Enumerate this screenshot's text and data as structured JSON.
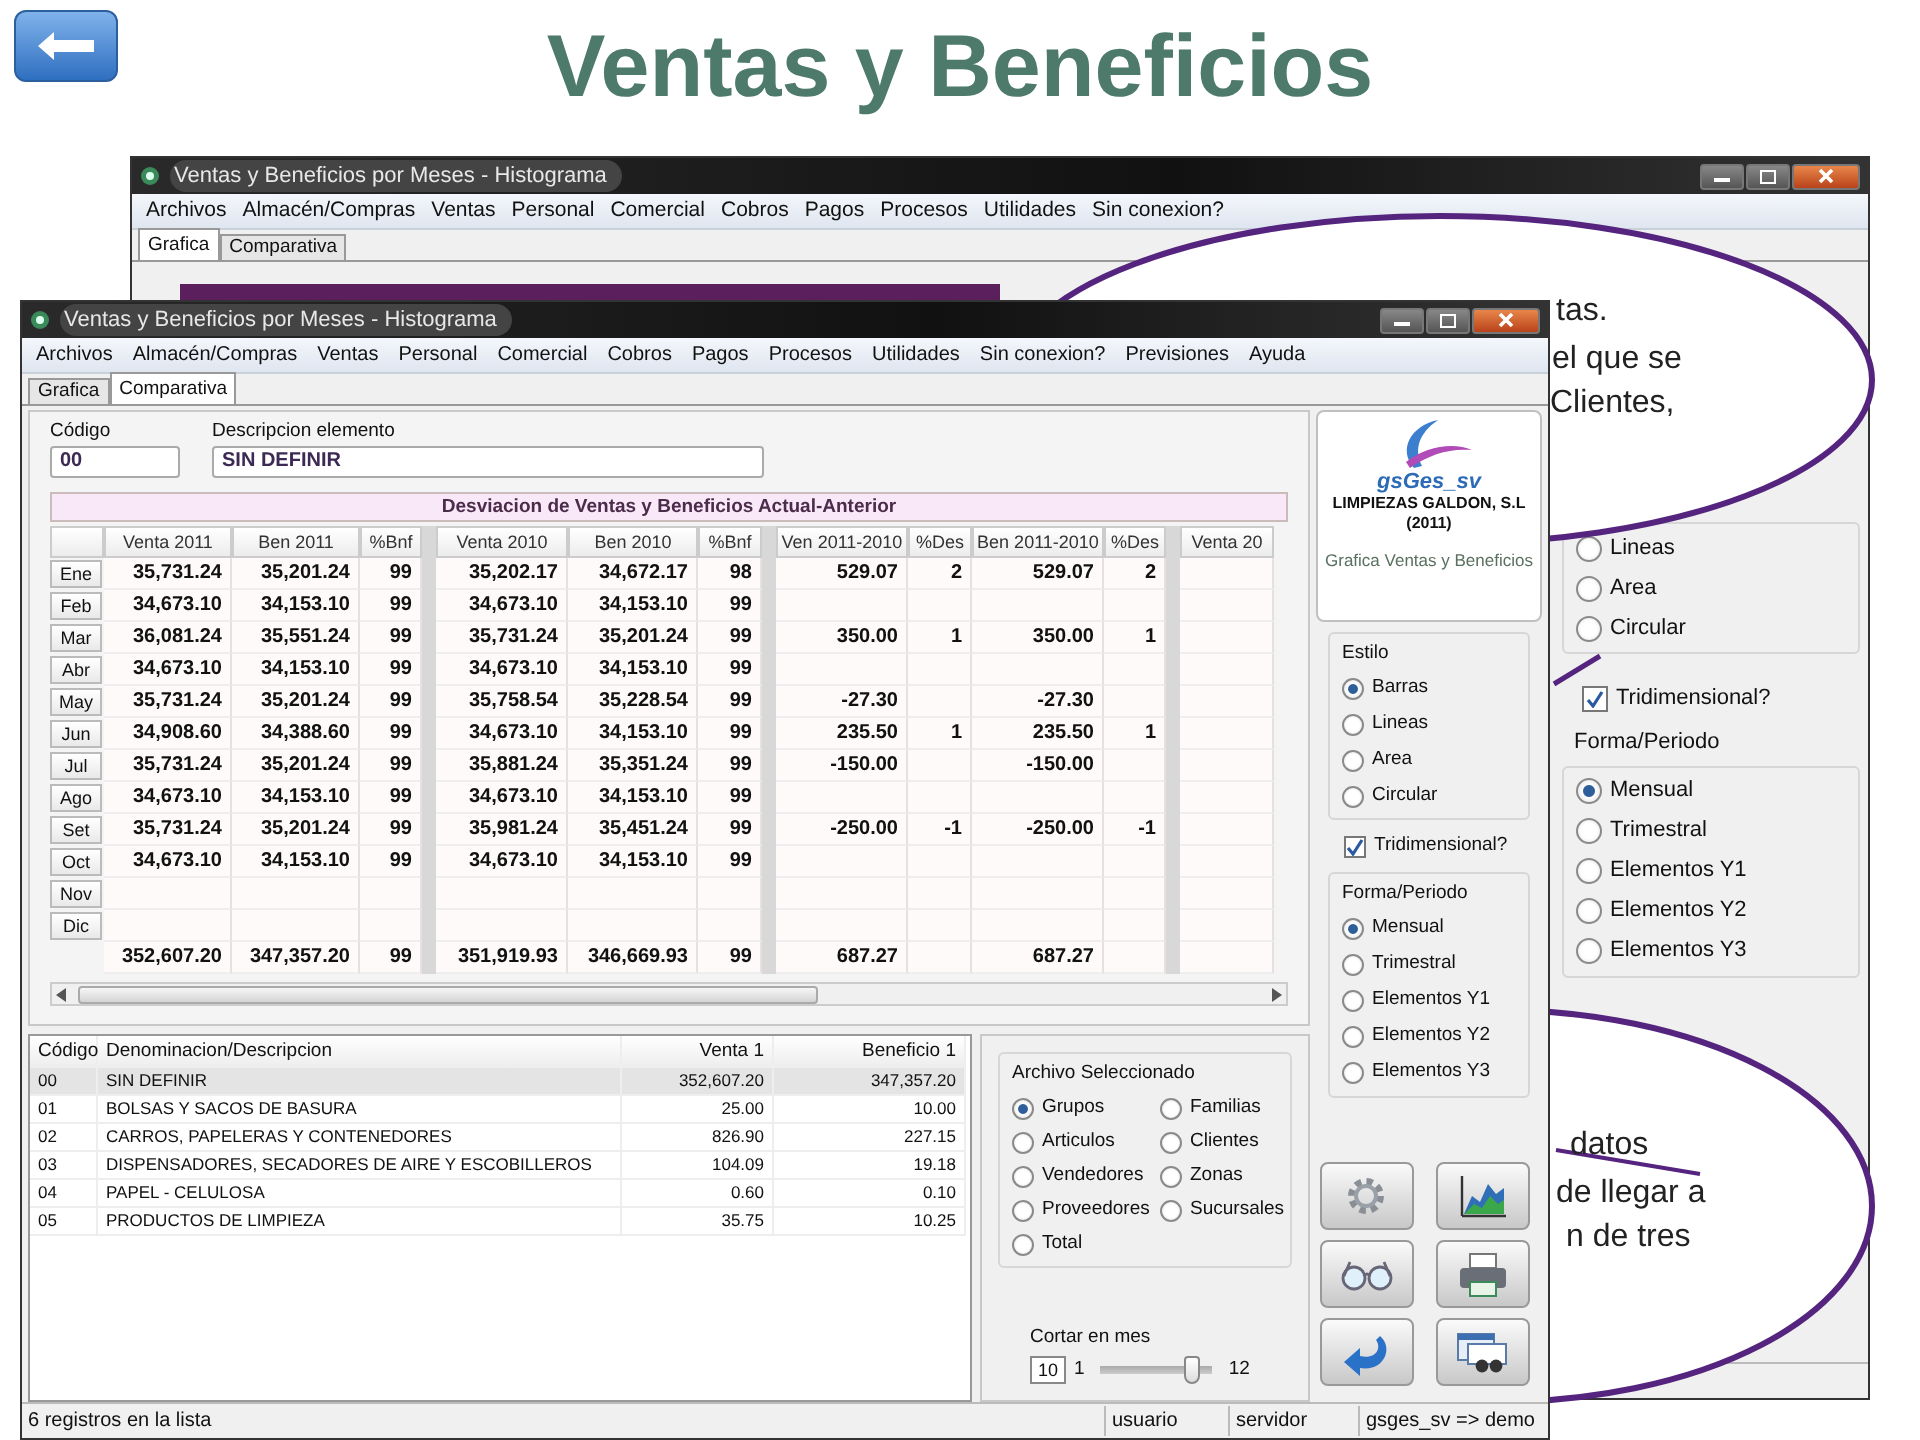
{
  "slide": {
    "title": "Ventas y Beneficios"
  },
  "background_window": {
    "title": "Ventas y Beneficios por Meses - Histograma",
    "menu": [
      "Archivos",
      "Almacén/Compras",
      "Ventas",
      "Personal",
      "Comercial",
      "Cobros",
      "Pagos",
      "Procesos",
      "Utilidades",
      "Sin conexion?"
    ],
    "tabs": [
      {
        "label": "Grafica",
        "selected": true
      },
      {
        "label": "Comparativa",
        "selected": false
      }
    ],
    "style_options": [
      {
        "label": "Lineas",
        "selected": false
      },
      {
        "label": "Area",
        "selected": false
      },
      {
        "label": "Circular",
        "selected": false
      }
    ],
    "tridimensional": {
      "label": "Tridimensional?",
      "checked": true
    },
    "period_group": {
      "title": "Forma/Periodo",
      "options": [
        {
          "label": "Mensual",
          "selected": true
        },
        {
          "label": "Trimestral",
          "selected": false
        },
        {
          "label": "Elementos Y1",
          "selected": false
        },
        {
          "label": "Elementos Y2",
          "selected": false
        },
        {
          "label": "Elementos Y3",
          "selected": false
        }
      ]
    }
  },
  "callouts": [
    {
      "lines": [
        "tas.",
        "el que se",
        "Clientes,"
      ]
    },
    {
      "lines": [
        "datos",
        "de llegar a",
        "n de tres"
      ]
    }
  ],
  "window": {
    "title": "Ventas y Beneficios por Meses - Histograma",
    "menu": [
      "Archivos",
      "Almacén/Compras",
      "Ventas",
      "Personal",
      "Comercial",
      "Cobros",
      "Pagos",
      "Procesos",
      "Utilidades",
      "Sin conexion?",
      "Previsiones",
      "Ayuda"
    ],
    "tabs": [
      {
        "label": "Grafica",
        "selected": false
      },
      {
        "label": "Comparativa",
        "selected": true
      }
    ],
    "codigo": {
      "label": "Código",
      "value": "00"
    },
    "descripcion": {
      "label": "Descripcion elemento",
      "value": "SIN DEFINIR"
    },
    "grid": {
      "title": "Desviacion de Ventas y Beneficios Actual-Anterior",
      "columns": [
        "Venta 2011",
        "Ben 2011",
        "%Bnf",
        "Venta 2010",
        "Ben 2010",
        "%Bnf",
        "Ven 2011-2010",
        "%Des",
        "Ben 2011-2010",
        "%Des",
        "Venta 20"
      ],
      "rows": [
        {
          "month": "Ene",
          "venta_2011": "35,731.24",
          "ben_2011": "35,201.24",
          "bnf_2011": "99",
          "venta_2010": "35,202.17",
          "ben_2010": "34,672.17",
          "bnf_2010": "98",
          "ven_2011_2010": "529.07",
          "des_ven": "2",
          "ben_2011_2010": "529.07",
          "des_ben": "2"
        },
        {
          "month": "Feb",
          "venta_2011": "34,673.10",
          "ben_2011": "34,153.10",
          "bnf_2011": "99",
          "venta_2010": "34,673.10",
          "ben_2010": "34,153.10",
          "bnf_2010": "99"
        },
        {
          "month": "Mar",
          "venta_2011": "36,081.24",
          "ben_2011": "35,551.24",
          "bnf_2011": "99",
          "venta_2010": "35,731.24",
          "ben_2010": "35,201.24",
          "bnf_2010": "99",
          "ven_2011_2010": "350.00",
          "des_ven": "1",
          "ben_2011_2010": "350.00",
          "des_ben": "1"
        },
        {
          "month": "Abr",
          "venta_2011": "34,673.10",
          "ben_2011": "34,153.10",
          "bnf_2011": "99",
          "venta_2010": "34,673.10",
          "ben_2010": "34,153.10",
          "bnf_2010": "99"
        },
        {
          "month": "May",
          "venta_2011": "35,731.24",
          "ben_2011": "35,201.24",
          "bnf_2011": "99",
          "venta_2010": "35,758.54",
          "ben_2010": "35,228.54",
          "bnf_2010": "99",
          "ven_2011_2010": "-27.30",
          "ben_2011_2010": "-27.30"
        },
        {
          "month": "Jun",
          "venta_2011": "34,908.60",
          "ben_2011": "34,388.60",
          "bnf_2011": "99",
          "venta_2010": "34,673.10",
          "ben_2010": "34,153.10",
          "bnf_2010": "99",
          "ven_2011_2010": "235.50",
          "des_ven": "1",
          "ben_2011_2010": "235.50",
          "des_ben": "1"
        },
        {
          "month": "Jul",
          "venta_2011": "35,731.24",
          "ben_2011": "35,201.24",
          "bnf_2011": "99",
          "venta_2010": "35,881.24",
          "ben_2010": "35,351.24",
          "bnf_2010": "99",
          "ven_2011_2010": "-150.00",
          "ben_2011_2010": "-150.00"
        },
        {
          "month": "Ago",
          "venta_2011": "34,673.10",
          "ben_2011": "34,153.10",
          "bnf_2011": "99",
          "venta_2010": "34,673.10",
          "ben_2010": "34,153.10",
          "bnf_2010": "99"
        },
        {
          "month": "Set",
          "venta_2011": "35,731.24",
          "ben_2011": "35,201.24",
          "bnf_2011": "99",
          "venta_2010": "35,981.24",
          "ben_2010": "35,451.24",
          "bnf_2010": "99",
          "ven_2011_2010": "-250.00",
          "des_ven": "-1",
          "ben_2011_2010": "-250.00",
          "des_ben": "-1"
        },
        {
          "month": "Oct",
          "venta_2011": "34,673.10",
          "ben_2011": "34,153.10",
          "bnf_2011": "99",
          "venta_2010": "34,673.10",
          "ben_2010": "34,153.10",
          "bnf_2010": "99"
        },
        {
          "month": "Nov"
        },
        {
          "month": "Dic"
        }
      ],
      "totals": {
        "venta_2011": "352,607.20",
        "ben_2011": "347,357.20",
        "bnf_2011": "99",
        "venta_2010": "351,919.93",
        "ben_2010": "346,669.93",
        "bnf_2010": "99",
        "ven_2011_2010": "687.27",
        "ben_2011_2010": "687.27"
      }
    },
    "list": {
      "columns": [
        "Código",
        "Denominacion/Descripcion",
        "Venta 1",
        "Beneficio 1"
      ],
      "rows": [
        {
          "cells": [
            "00",
            "SIN DEFINIR",
            "352,607.20",
            "347,357.20"
          ],
          "selected": true
        },
        {
          "cells": [
            "01",
            "BOLSAS Y SACOS DE BASURA",
            "25.00",
            "10.00"
          ],
          "selected": false
        },
        {
          "cells": [
            "02",
            "CARROS, PAPELERAS Y CONTENEDORES",
            "826.90",
            "227.15"
          ],
          "selected": false
        },
        {
          "cells": [
            "03",
            "DISPENSADORES, SECADORES DE AIRE Y ESCOBILLEROS",
            "104.09",
            "19.18"
          ],
          "selected": false
        },
        {
          "cells": [
            "04",
            "PAPEL - CELULOSA",
            "0.60",
            "0.10"
          ],
          "selected": false
        },
        {
          "cells": [
            "05",
            "PRODUCTOS DE LIMPIEZA",
            "35.75",
            "10.25"
          ],
          "selected": false
        }
      ]
    },
    "archivo": {
      "title": "Archivo Seleccionado",
      "options": [
        {
          "label": "Grupos",
          "selected": true
        },
        {
          "label": "Familias",
          "selected": false
        },
        {
          "label": "Articulos",
          "selected": false
        },
        {
          "label": "Clientes",
          "selected": false
        },
        {
          "label": "Vendedores",
          "selected": false
        },
        {
          "label": "Zonas",
          "selected": false
        },
        {
          "label": "Proveedores",
          "selected": false
        },
        {
          "label": "Sucursales",
          "selected": false
        },
        {
          "label": "Total",
          "selected": false
        }
      ]
    },
    "cortar": {
      "label": "Cortar en mes",
      "value": "10",
      "min": "1",
      "max": "12",
      "level": 0.82
    },
    "logo": {
      "brand": "gsGes_sv",
      "company": "LIMPIEZAS GALDON, S.L",
      "year": "(2011)",
      "caption": "Grafica Ventas y Beneficios"
    },
    "estilo": {
      "title": "Estilo",
      "options": [
        {
          "label": "Barras",
          "selected": true
        },
        {
          "label": "Lineas",
          "selected": false
        },
        {
          "label": "Area",
          "selected": false
        },
        {
          "label": "Circular",
          "selected": false
        }
      ]
    },
    "tridimensional": {
      "label": "Tridimensional?",
      "checked": true
    },
    "forma": {
      "title": "Forma/Periodo",
      "options": [
        {
          "label": "Mensual",
          "selected": true
        },
        {
          "label": "Trimestral",
          "selected": false
        },
        {
          "label": "Elementos Y1",
          "selected": false
        },
        {
          "label": "Elementos Y2",
          "selected": false
        },
        {
          "label": "Elementos Y3",
          "selected": false
        }
      ]
    },
    "tool_buttons": [
      {
        "kind": "gear"
      },
      {
        "kind": "chart"
      },
      {
        "kind": "glasses"
      },
      {
        "kind": "printer"
      },
      {
        "kind": "undo"
      },
      {
        "kind": "binoculars"
      }
    ],
    "status_bar": [
      "6 registros en la lista",
      "usuario",
      "servidor",
      "gsges_sv => demo"
    ]
  }
}
